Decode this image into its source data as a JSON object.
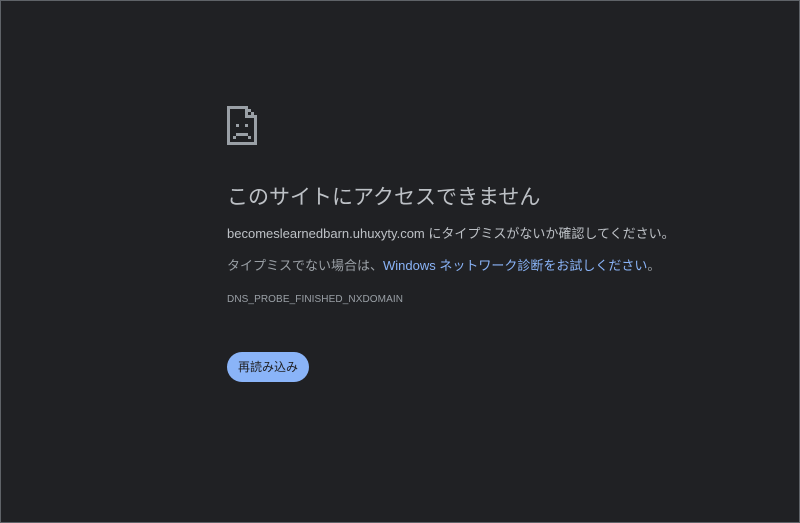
{
  "error_page": {
    "icon": "sad-document-icon",
    "title": "このサイトにアクセスできません",
    "domain_text": "becomeslearnedbarn.uhuxyty.com",
    "typo_message": " にタイプミスがないか確認してください。",
    "not_typo_prefix": "タイプミスでない場合は、",
    "diagnostics_link": "Windows ネットワーク診断をお試しください",
    "not_typo_suffix": "。",
    "error_code": "DNS_PROBE_FINISHED_NXDOMAIN",
    "reload_label": "再読み込み"
  },
  "colors": {
    "background": "#202124",
    "title_text": "#bdc1c6",
    "body_text": "#9aa0a6",
    "link": "#8ab4f8",
    "button_bg": "#8ab4f8",
    "button_text": "#202124"
  }
}
